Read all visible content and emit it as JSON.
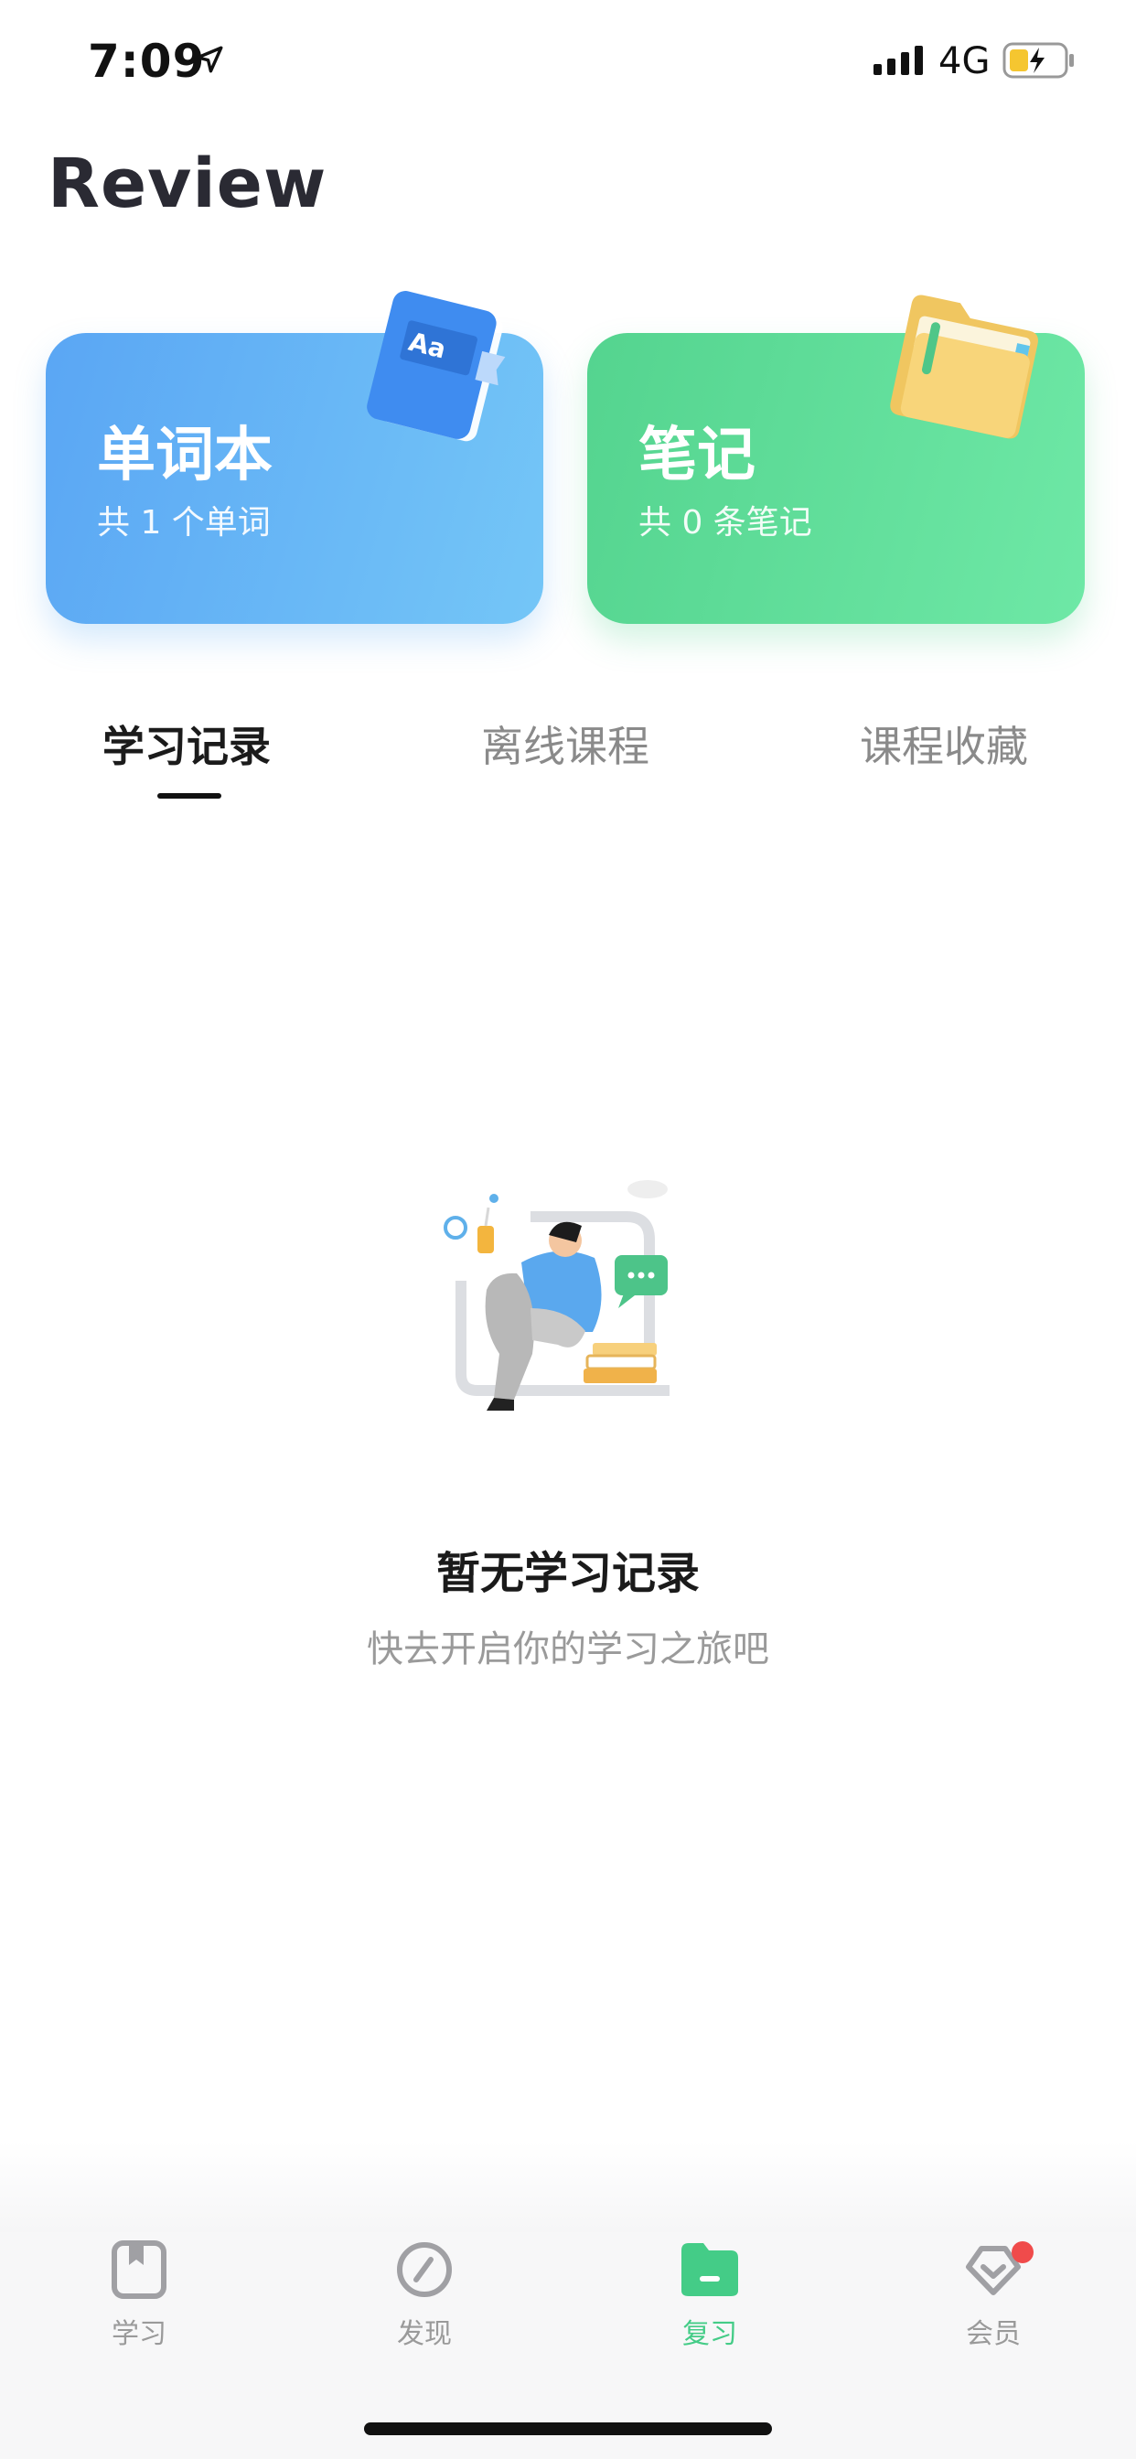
{
  "status": {
    "time": "7:09",
    "network": "4G"
  },
  "page": {
    "title": "Review"
  },
  "cards": {
    "wordbook": {
      "title": "单词本",
      "subtitle": "共 1 个单词",
      "badge": "Aa"
    },
    "notes": {
      "title": "笔记",
      "subtitle": "共 0 条笔记"
    }
  },
  "tabs": [
    {
      "label": "学习记录",
      "active": true
    },
    {
      "label": "离线课程",
      "active": false
    },
    {
      "label": "课程收藏",
      "active": false
    }
  ],
  "empty": {
    "title": "暂无学习记录",
    "subtitle": "快去开启你的学习之旅吧"
  },
  "tabbar": [
    {
      "label": "学习",
      "icon": "book-icon",
      "active": false
    },
    {
      "label": "发现",
      "icon": "compass-icon",
      "active": false
    },
    {
      "label": "复习",
      "icon": "folder-icon",
      "active": true
    },
    {
      "label": "会员",
      "icon": "diamond-icon",
      "active": false,
      "badge": true
    }
  ],
  "colors": {
    "accent_green": "#44cc87",
    "wordbook_blue": "#5aa6f4",
    "notes_green": "#54d48f",
    "badge_red": "#f04b4b"
  }
}
